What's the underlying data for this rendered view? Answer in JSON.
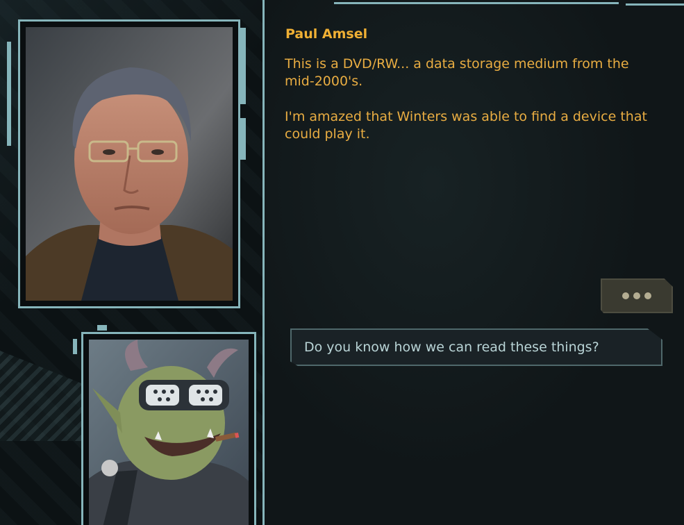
{
  "dialog": {
    "speaker_name": "Paul Amsel",
    "lines": [
      "This is a DVD/RW... a data storage medium from the mid-2000's.",
      "I'm amazed that Winters was able to find a device that could play it."
    ]
  },
  "continue_button": {
    "icon": "ellipsis-icon"
  },
  "responses": [
    {
      "label": "Do you know how we can read these things?"
    }
  ],
  "colors": {
    "frame": "#86b5bb",
    "speaker_text": "#f0b034",
    "dialog_text": "#e9ad42",
    "response_text": "#b9d4d6"
  }
}
